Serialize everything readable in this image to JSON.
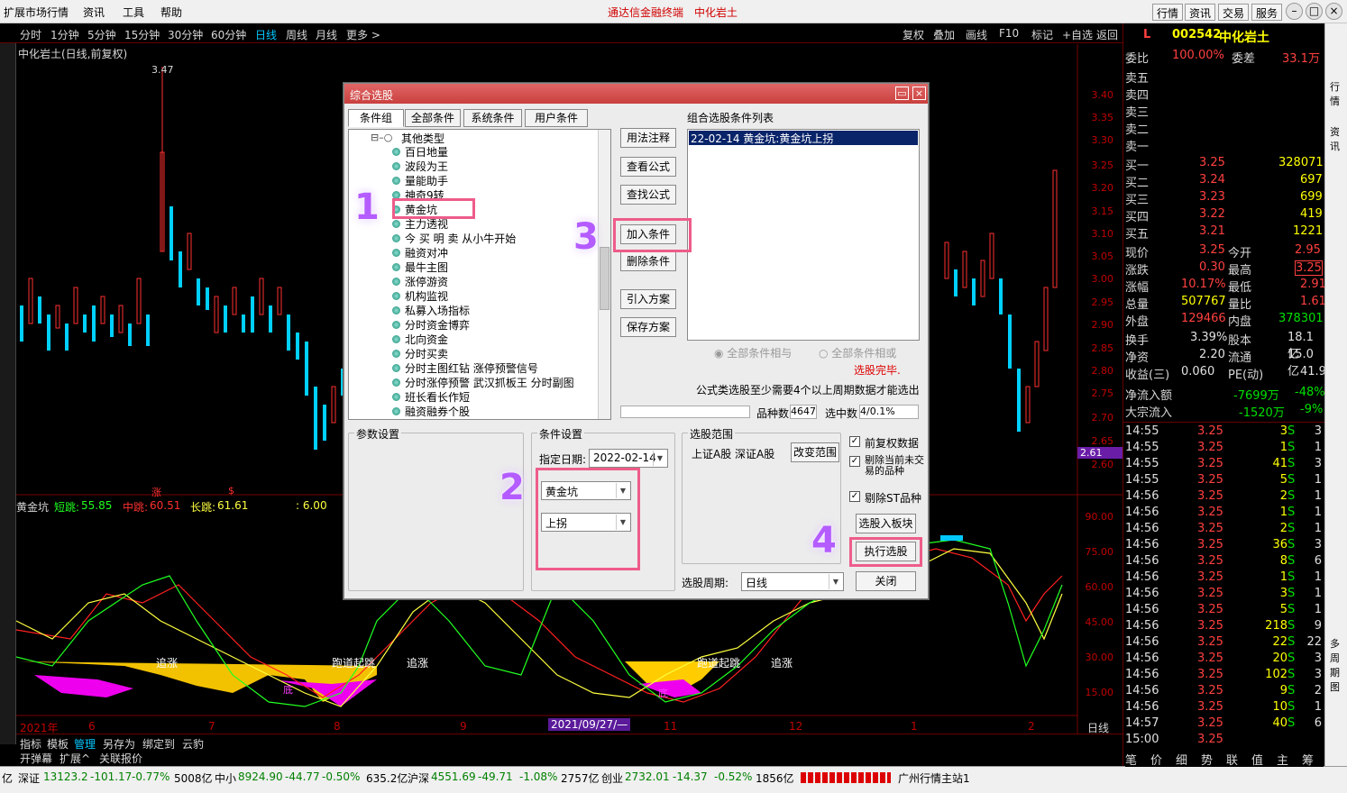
{
  "menubar": {
    "items": [
      "扩展市场行情",
      "资讯",
      "工具",
      "帮助"
    ],
    "center_title": "通达信金融终端",
    "center_stock": "中化岩土",
    "right_buttons": [
      "行情",
      "资讯",
      "交易",
      "服务"
    ]
  },
  "periodbar": {
    "periods": [
      "分时",
      "1分钟",
      "5分钟",
      "15分钟",
      "30分钟",
      "60分钟",
      "日线",
      "周线",
      "月线",
      "更多 >"
    ],
    "selected": "日线",
    "tools": [
      "复权",
      "叠加",
      "画线",
      "F10",
      "标记",
      "+自选",
      "返回"
    ]
  },
  "chart": {
    "title": "中化岩土(日线,前复权)",
    "high_label": "3.47",
    "price_ticks": [
      "3.40",
      "3.35",
      "3.30",
      "3.25",
      "3.20",
      "3.15",
      "3.10",
      "3.05",
      "3.00",
      "2.95",
      "2.90",
      "2.85",
      "2.80",
      "2.75",
      "2.70",
      "2.65",
      "2.60"
    ],
    "current_price_tag": "2.61",
    "markers": [
      "涨",
      "$"
    ],
    "indicator": {
      "name": "黄金坑",
      "short_label": "短跳:",
      "short_val": "55.85",
      "mid_label": "中跳:",
      "mid_val": "60.51",
      "long_label": "长跳:",
      "long_val": "61.61",
      "extra": ": 6.00",
      "ticks": [
        "90.00",
        "75.00",
        "60.00",
        "45.00",
        "30.00",
        "15.00"
      ],
      "annotations": [
        "追涨",
        "跑道起跳",
        "追涨",
        "跑道起跳",
        "追涨",
        "底",
        "底"
      ]
    },
    "xaxis": [
      "2021年",
      "6",
      "7",
      "8",
      "9",
      "2021/09/27/—",
      "11",
      "12",
      "1",
      "2"
    ],
    "xaxis_right": "日线"
  },
  "bottomtabs": [
    "指标",
    "模板",
    "管理",
    "另存为",
    "绑定到",
    "云豹"
  ],
  "bottomtabs2": [
    "开弹幕",
    "扩展^",
    "关联报价"
  ],
  "status": {
    "items": [
      {
        "name": "亿",
        "val": "",
        "chg": "",
        "pct": "",
        "amt": ""
      },
      {
        "name": "深证",
        "val": "13123.2",
        "chg": "-101.17",
        "pct": "-0.77%",
        "amt": "5008亿"
      },
      {
        "name": "中小",
        "val": "8924.90",
        "chg": "-44.77",
        "pct": "-0.50%",
        "amt": "635.2亿"
      },
      {
        "name": "沪深",
        "val": "4551.69",
        "chg": "-49.71",
        "pct": "-1.08%",
        "amt": "2757亿"
      },
      {
        "name": "创业",
        "val": "2732.01",
        "chg": "-14.37",
        "pct": "-0.52%",
        "amt": "1856亿"
      }
    ],
    "site": "广州行情主站1"
  },
  "quote": {
    "code": "002542",
    "name": "中化岩土",
    "flag": "L",
    "weibi_label": "委比",
    "weibi": "100.00%",
    "weicha_label": "委差",
    "weicha": "33.1万",
    "sells": [
      "卖五",
      "卖四",
      "卖三",
      "卖二",
      "卖一"
    ],
    "buys": [
      {
        "label": "买一",
        "price": "3.25",
        "vol": "328071"
      },
      {
        "label": "买二",
        "price": "3.24",
        "vol": "697"
      },
      {
        "label": "买三",
        "price": "3.23",
        "vol": "699"
      },
      {
        "label": "买四",
        "price": "3.22",
        "vol": "419"
      },
      {
        "label": "买五",
        "price": "3.21",
        "vol": "1221"
      }
    ],
    "stats": [
      {
        "l1": "现价",
        "v1": "3.25",
        "l2": "今开",
        "v2": "2.95"
      },
      {
        "l1": "涨跌",
        "v1": "0.30",
        "l2": "最高",
        "v2": "3.25"
      },
      {
        "l1": "涨幅",
        "v1": "10.17%",
        "l2": "最低",
        "v2": "2.91"
      },
      {
        "l1": "总量",
        "v1": "507767",
        "l2": "量比",
        "v2": "1.61"
      },
      {
        "l1": "外盘",
        "v1": "129466",
        "l2": "内盘",
        "v2": "378301"
      },
      {
        "l1": "换手",
        "v1": "3.39%",
        "l2": "股本",
        "v2": "18.1亿"
      },
      {
        "l1": "净资",
        "v1": "2.20",
        "l2": "流通",
        "v2": "15.0亿"
      },
      {
        "l1": "收益(三)",
        "v1": "0.060",
        "l2": "PE(动)",
        "v2": "41.9"
      }
    ],
    "flows": [
      {
        "label": "净流入额",
        "val": "-7699万",
        "pct": "-48%"
      },
      {
        "label": "大宗流入",
        "val": "-1520万",
        "pct": "-9%"
      }
    ],
    "ticks": [
      {
        "t": "14:55",
        "p": "3.25",
        "v": "3",
        "s": "S",
        "n": "3"
      },
      {
        "t": "14:55",
        "p": "3.25",
        "v": "1",
        "s": "S",
        "n": "1"
      },
      {
        "t": "14:55",
        "p": "3.25",
        "v": "41",
        "s": "S",
        "n": "3"
      },
      {
        "t": "14:55",
        "p": "3.25",
        "v": "5",
        "s": "S",
        "n": "1"
      },
      {
        "t": "14:56",
        "p": "3.25",
        "v": "2",
        "s": "S",
        "n": "1"
      },
      {
        "t": "14:56",
        "p": "3.25",
        "v": "1",
        "s": "S",
        "n": "1"
      },
      {
        "t": "14:56",
        "p": "3.25",
        "v": "2",
        "s": "S",
        "n": "1"
      },
      {
        "t": "14:56",
        "p": "3.25",
        "v": "36",
        "s": "S",
        "n": "3"
      },
      {
        "t": "14:56",
        "p": "3.25",
        "v": "8",
        "s": "S",
        "n": "6"
      },
      {
        "t": "14:56",
        "p": "3.25",
        "v": "1",
        "s": "S",
        "n": "1"
      },
      {
        "t": "14:56",
        "p": "3.25",
        "v": "3",
        "s": "S",
        "n": "1"
      },
      {
        "t": "14:56",
        "p": "3.25",
        "v": "5",
        "s": "S",
        "n": "1"
      },
      {
        "t": "14:56",
        "p": "3.25",
        "v": "218",
        "s": "S",
        "n": "9"
      },
      {
        "t": "14:56",
        "p": "3.25",
        "v": "22",
        "s": "S",
        "n": "22"
      },
      {
        "t": "14:56",
        "p": "3.25",
        "v": "20",
        "s": "S",
        "n": "3"
      },
      {
        "t": "14:56",
        "p": "3.25",
        "v": "102",
        "s": "S",
        "n": "3"
      },
      {
        "t": "14:56",
        "p": "3.25",
        "v": "9",
        "s": "S",
        "n": "2"
      },
      {
        "t": "14:56",
        "p": "3.25",
        "v": "10",
        "s": "S",
        "n": "1"
      },
      {
        "t": "14:57",
        "p": "3.25",
        "v": "40",
        "s": "S",
        "n": "6"
      },
      {
        "t": "15:00",
        "p": "3.25",
        "v": "",
        "s": "",
        "n": ""
      }
    ],
    "bottom_tabs": [
      "笔",
      "价",
      "细",
      "势",
      "联",
      "值",
      "主",
      "筹"
    ]
  },
  "farright": [
    "行",
    "情",
    "资",
    "讯",
    "多",
    "周",
    "期",
    "图"
  ],
  "dialog": {
    "title": "综合选股",
    "tabs": [
      "条件组",
      "全部条件",
      "系统条件",
      "用户条件"
    ],
    "tree_root": "其他类型",
    "tree_items": [
      "百日地量",
      "波段为王",
      "量能助手",
      "神奇9转",
      "黄金坑",
      "主力透视",
      "今 买 明 卖 从小牛开始",
      "融资对冲",
      "最牛主图",
      "涨停游资",
      "机构监视",
      "私募入场指标",
      "分时资金博弈",
      "北向资金",
      "分时买卖",
      "分时主图红钻 涨停预警信号",
      "分时涨停预警 武汉抓板王 分时副图",
      "班长看长作短",
      "融资融券个股"
    ],
    "mid_buttons": [
      "用法注释",
      "查看公式",
      "查找公式",
      "加入条件",
      "删除条件",
      "引入方案",
      "保存方案"
    ],
    "list_title": "组合选股条件列表",
    "list_items": [
      "22-02-14 黄金坑:黄金坑上拐"
    ],
    "radio_and": "全部条件相与",
    "radio_or": "全部条件相或",
    "done_text": "选股完毕.",
    "note": "公式类选股至少需要4个以上周期数据才能选出",
    "count_label": "品种数",
    "count_val": "4647",
    "sel_label": "选中数",
    "sel_val": "4/0.1%",
    "param_group": "参数设置",
    "cond_group": "条件设置",
    "date_label": "指定日期:",
    "date_val": "2022-02-14",
    "cond_combo1": "黄金坑",
    "cond_combo2": "上拐",
    "range_group": "选股范围",
    "range_text": "上证A股 深证A股",
    "range_btn": "改变范围",
    "checks": [
      {
        "label": "前复权数据",
        "checked": true
      },
      {
        "label": "剔除当前未交易的品种",
        "checked": true
      },
      {
        "label": "剔除ST品种",
        "checked": true
      }
    ],
    "to_board": "选股入板块",
    "execute": "执行选股",
    "period_label": "选股周期:",
    "period_val": "日线",
    "close": "关闭"
  },
  "annotations": [
    "1",
    "2",
    "3",
    "4"
  ]
}
